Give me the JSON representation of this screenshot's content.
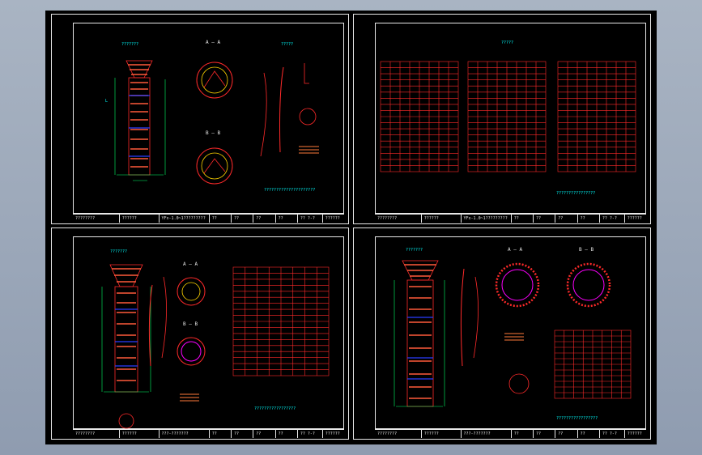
{
  "window": {
    "background": "#000000",
    "line_color": "#ff1a1a",
    "text_color": "#00ffff",
    "frame_color": "#e8e8e8"
  },
  "sheets": [
    {
      "section_a_label": "A — A",
      "section_b_label": "B — B",
      "title_cells": [
        "????????",
        "??????",
        "YFx-1.0~1?????????",
        "??",
        "??",
        "??",
        "??",
        "?? ?-?",
        "??????"
      ]
    },
    {
      "title_cells": [
        "????????",
        "??????",
        "YFx-1.0~1?????????",
        "??",
        "??",
        "??",
        "??",
        "?? ?-?",
        "??????"
      ]
    },
    {
      "section_a_label": "A — A",
      "section_b_label": "B — B",
      "title_cells": [
        "????????",
        "??????",
        "???-???????",
        "??",
        "??",
        "??",
        "??",
        "?? ?-?",
        "??????"
      ]
    },
    {
      "section_a_label": "A — A",
      "section_b_label": "B — B",
      "title_cells": [
        "????????",
        "??????",
        "???-???????",
        "??",
        "??",
        "??",
        "??",
        "?? ?-?",
        "??????"
      ]
    }
  ]
}
